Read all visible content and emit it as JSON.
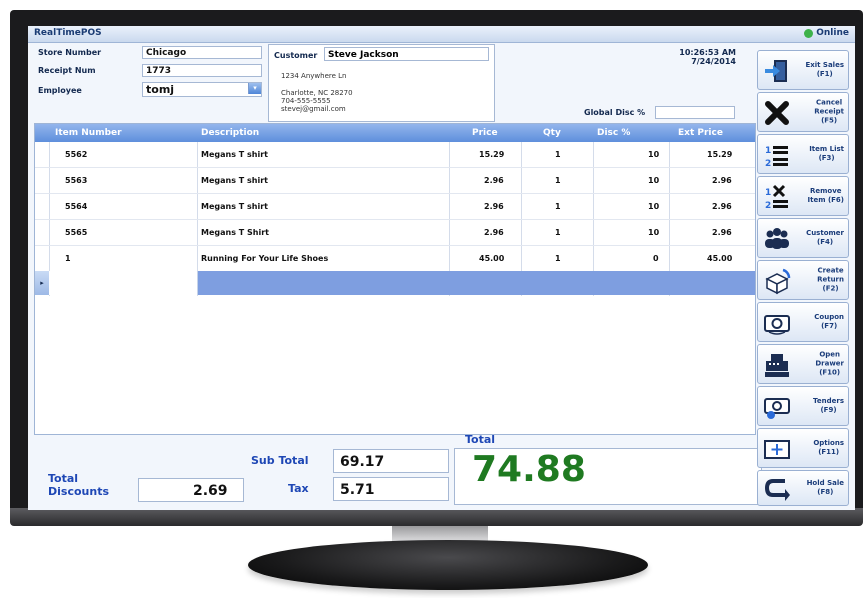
{
  "app": {
    "title": "RealTimePOS",
    "status": "Online"
  },
  "header": {
    "store_label": "Store Number",
    "store_value": "Chicago",
    "receipt_label": "Receipt Num",
    "receipt_value": "1773",
    "employee_label": "Employee",
    "employee_value": "tomj",
    "customer_label": "Customer",
    "customer_name": "Steve Jackson",
    "customer_address1": "1234 Anywhere Ln",
    "customer_address2": "Charlotte, NC 28270",
    "customer_phone": "704-555-5555",
    "customer_email": "stevej@gmail.com",
    "time": "10:26:53 AM",
    "date": "7/24/2014",
    "global_disc_label": "Global Disc %",
    "global_disc_value": ""
  },
  "grid": {
    "columns": [
      "Item Number",
      "Description",
      "Price",
      "Qty",
      "Disc %",
      "Ext Price"
    ],
    "rows": [
      [
        "5562",
        "Megans T shirt",
        "15.29",
        "1",
        "10",
        "15.29"
      ],
      [
        "5563",
        "Megans T shirt",
        "2.96",
        "1",
        "10",
        "2.96"
      ],
      [
        "5564",
        "Megans T shirt",
        "2.96",
        "1",
        "10",
        "2.96"
      ],
      [
        "5565",
        "Megans T Shirt",
        "2.96",
        "1",
        "10",
        "2.96"
      ],
      [
        "1",
        "Running For Your Life Shoes",
        "45.00",
        "1",
        "0",
        "45.00"
      ]
    ]
  },
  "totals": {
    "subtotal_label": "Sub Total",
    "subtotal_value": "69.17",
    "tax_label": "Tax",
    "tax_value": "5.71",
    "discounts_label_line1": "Total",
    "discounts_label_line2": "Discounts",
    "discounts_value": "2.69",
    "total_label": "Total",
    "total_value": "74.88"
  },
  "actions": [
    {
      "l1": "Exit Sales",
      "l2": "(F1)",
      "icon": "exit-icon"
    },
    {
      "l1": "Cancel",
      "l2": "Receipt",
      "l3": "(F5)",
      "icon": "cancel-icon"
    },
    {
      "l1": "Item List",
      "l2": "(F3)",
      "icon": "list-icon"
    },
    {
      "l1": "Remove",
      "l2": "Item (F6)",
      "icon": "remove-icon"
    },
    {
      "l1": "Customer",
      "l2": "(F4)",
      "icon": "customer-icon"
    },
    {
      "l1": "Create",
      "l2": "Return",
      "l3": "(F2)",
      "icon": "return-icon"
    },
    {
      "l1": "Coupon",
      "l2": "(F7)",
      "icon": "coupon-icon"
    },
    {
      "l1": "Open",
      "l2": "Drawer",
      "l3": "(F10)",
      "icon": "register-icon"
    },
    {
      "l1": "Tenders",
      "l2": "(F9)",
      "icon": "tenders-icon"
    },
    {
      "l1": "Options",
      "l2": "(F11)",
      "icon": "options-icon"
    },
    {
      "l1": "Hold Sale",
      "l2": "(F8)",
      "icon": "hold-icon"
    }
  ],
  "colors": {
    "accent": "#5e8fdc",
    "total_green": "#1f7a21",
    "label_blue": "#1e47b5"
  }
}
